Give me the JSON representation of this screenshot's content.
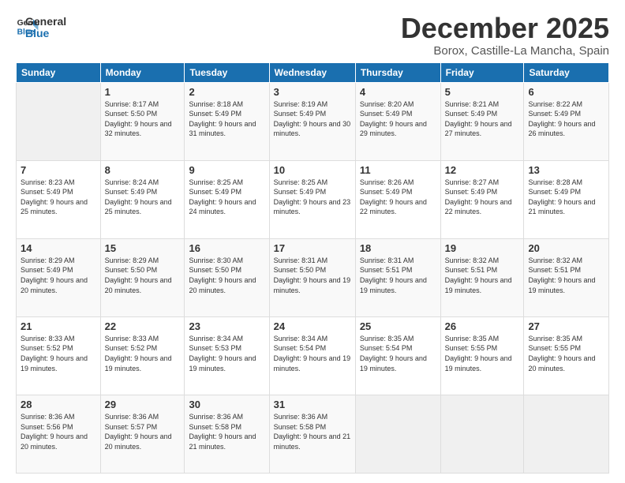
{
  "logo": {
    "text1": "General",
    "text2": "Blue"
  },
  "title": "December 2025",
  "subtitle": "Borox, Castille-La Mancha, Spain",
  "headers": [
    "Sunday",
    "Monday",
    "Tuesday",
    "Wednesday",
    "Thursday",
    "Friday",
    "Saturday"
  ],
  "weeks": [
    [
      {
        "day": "",
        "sunrise": "",
        "sunset": "",
        "daylight": ""
      },
      {
        "day": "1",
        "sunrise": "Sunrise: 8:17 AM",
        "sunset": "Sunset: 5:50 PM",
        "daylight": "Daylight: 9 hours and 32 minutes."
      },
      {
        "day": "2",
        "sunrise": "Sunrise: 8:18 AM",
        "sunset": "Sunset: 5:49 PM",
        "daylight": "Daylight: 9 hours and 31 minutes."
      },
      {
        "day": "3",
        "sunrise": "Sunrise: 8:19 AM",
        "sunset": "Sunset: 5:49 PM",
        "daylight": "Daylight: 9 hours and 30 minutes."
      },
      {
        "day": "4",
        "sunrise": "Sunrise: 8:20 AM",
        "sunset": "Sunset: 5:49 PM",
        "daylight": "Daylight: 9 hours and 29 minutes."
      },
      {
        "day": "5",
        "sunrise": "Sunrise: 8:21 AM",
        "sunset": "Sunset: 5:49 PM",
        "daylight": "Daylight: 9 hours and 27 minutes."
      },
      {
        "day": "6",
        "sunrise": "Sunrise: 8:22 AM",
        "sunset": "Sunset: 5:49 PM",
        "daylight": "Daylight: 9 hours and 26 minutes."
      }
    ],
    [
      {
        "day": "7",
        "sunrise": "Sunrise: 8:23 AM",
        "sunset": "Sunset: 5:49 PM",
        "daylight": "Daylight: 9 hours and 25 minutes."
      },
      {
        "day": "8",
        "sunrise": "Sunrise: 8:24 AM",
        "sunset": "Sunset: 5:49 PM",
        "daylight": "Daylight: 9 hours and 25 minutes."
      },
      {
        "day": "9",
        "sunrise": "Sunrise: 8:25 AM",
        "sunset": "Sunset: 5:49 PM",
        "daylight": "Daylight: 9 hours and 24 minutes."
      },
      {
        "day": "10",
        "sunrise": "Sunrise: 8:25 AM",
        "sunset": "Sunset: 5:49 PM",
        "daylight": "Daylight: 9 hours and 23 minutes."
      },
      {
        "day": "11",
        "sunrise": "Sunrise: 8:26 AM",
        "sunset": "Sunset: 5:49 PM",
        "daylight": "Daylight: 9 hours and 22 minutes."
      },
      {
        "day": "12",
        "sunrise": "Sunrise: 8:27 AM",
        "sunset": "Sunset: 5:49 PM",
        "daylight": "Daylight: 9 hours and 22 minutes."
      },
      {
        "day": "13",
        "sunrise": "Sunrise: 8:28 AM",
        "sunset": "Sunset: 5:49 PM",
        "daylight": "Daylight: 9 hours and 21 minutes."
      }
    ],
    [
      {
        "day": "14",
        "sunrise": "Sunrise: 8:29 AM",
        "sunset": "Sunset: 5:49 PM",
        "daylight": "Daylight: 9 hours and 20 minutes."
      },
      {
        "day": "15",
        "sunrise": "Sunrise: 8:29 AM",
        "sunset": "Sunset: 5:50 PM",
        "daylight": "Daylight: 9 hours and 20 minutes."
      },
      {
        "day": "16",
        "sunrise": "Sunrise: 8:30 AM",
        "sunset": "Sunset: 5:50 PM",
        "daylight": "Daylight: 9 hours and 20 minutes."
      },
      {
        "day": "17",
        "sunrise": "Sunrise: 8:31 AM",
        "sunset": "Sunset: 5:50 PM",
        "daylight": "Daylight: 9 hours and 19 minutes."
      },
      {
        "day": "18",
        "sunrise": "Sunrise: 8:31 AM",
        "sunset": "Sunset: 5:51 PM",
        "daylight": "Daylight: 9 hours and 19 minutes."
      },
      {
        "day": "19",
        "sunrise": "Sunrise: 8:32 AM",
        "sunset": "Sunset: 5:51 PM",
        "daylight": "Daylight: 9 hours and 19 minutes."
      },
      {
        "day": "20",
        "sunrise": "Sunrise: 8:32 AM",
        "sunset": "Sunset: 5:51 PM",
        "daylight": "Daylight: 9 hours and 19 minutes."
      }
    ],
    [
      {
        "day": "21",
        "sunrise": "Sunrise: 8:33 AM",
        "sunset": "Sunset: 5:52 PM",
        "daylight": "Daylight: 9 hours and 19 minutes."
      },
      {
        "day": "22",
        "sunrise": "Sunrise: 8:33 AM",
        "sunset": "Sunset: 5:52 PM",
        "daylight": "Daylight: 9 hours and 19 minutes."
      },
      {
        "day": "23",
        "sunrise": "Sunrise: 8:34 AM",
        "sunset": "Sunset: 5:53 PM",
        "daylight": "Daylight: 9 hours and 19 minutes."
      },
      {
        "day": "24",
        "sunrise": "Sunrise: 8:34 AM",
        "sunset": "Sunset: 5:54 PM",
        "daylight": "Daylight: 9 hours and 19 minutes."
      },
      {
        "day": "25",
        "sunrise": "Sunrise: 8:35 AM",
        "sunset": "Sunset: 5:54 PM",
        "daylight": "Daylight: 9 hours and 19 minutes."
      },
      {
        "day": "26",
        "sunrise": "Sunrise: 8:35 AM",
        "sunset": "Sunset: 5:55 PM",
        "daylight": "Daylight: 9 hours and 19 minutes."
      },
      {
        "day": "27",
        "sunrise": "Sunrise: 8:35 AM",
        "sunset": "Sunset: 5:55 PM",
        "daylight": "Daylight: 9 hours and 20 minutes."
      }
    ],
    [
      {
        "day": "28",
        "sunrise": "Sunrise: 8:36 AM",
        "sunset": "Sunset: 5:56 PM",
        "daylight": "Daylight: 9 hours and 20 minutes."
      },
      {
        "day": "29",
        "sunrise": "Sunrise: 8:36 AM",
        "sunset": "Sunset: 5:57 PM",
        "daylight": "Daylight: 9 hours and 20 minutes."
      },
      {
        "day": "30",
        "sunrise": "Sunrise: 8:36 AM",
        "sunset": "Sunset: 5:58 PM",
        "daylight": "Daylight: 9 hours and 21 minutes."
      },
      {
        "day": "31",
        "sunrise": "Sunrise: 8:36 AM",
        "sunset": "Sunset: 5:58 PM",
        "daylight": "Daylight: 9 hours and 21 minutes."
      },
      {
        "day": "",
        "sunrise": "",
        "sunset": "",
        "daylight": ""
      },
      {
        "day": "",
        "sunrise": "",
        "sunset": "",
        "daylight": ""
      },
      {
        "day": "",
        "sunrise": "",
        "sunset": "",
        "daylight": ""
      }
    ]
  ]
}
